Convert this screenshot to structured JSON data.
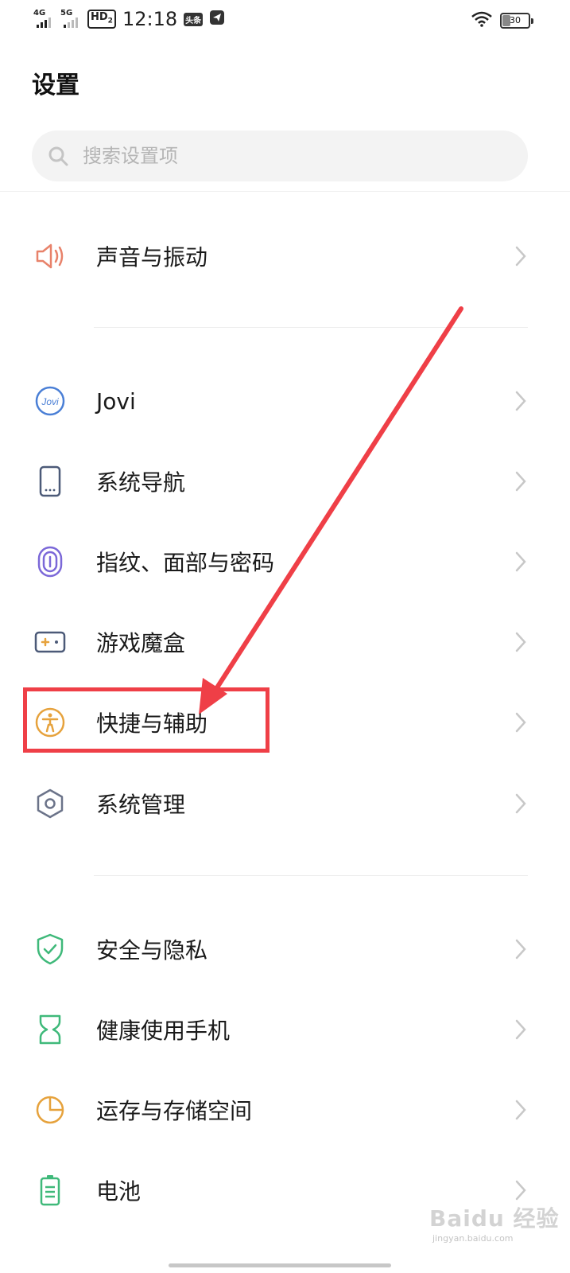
{
  "status_bar": {
    "signal1_label": "4G",
    "signal2_label": "5G",
    "hd_label": "HD",
    "hd_sub": "2",
    "time": "12:18",
    "app_badge": "头条",
    "battery_level": "30"
  },
  "header": {
    "title": "设置"
  },
  "search": {
    "placeholder": "搜索设置项"
  },
  "settings_items": [
    {
      "label": "声音与振动",
      "icon": "speaker-icon",
      "color": "#e8826a"
    },
    {
      "label": "Jovi",
      "icon": "jovi-icon",
      "color": "#4a7fd6"
    },
    {
      "label": "系统导航",
      "icon": "phone-icon",
      "color": "#4c5a78"
    },
    {
      "label": "指纹、面部与密码",
      "icon": "fingerprint-icon",
      "color": "#7b68d8"
    },
    {
      "label": "游戏魔盒",
      "icon": "gamepad-icon",
      "color": "#4c5a78"
    },
    {
      "label": "快捷与辅助",
      "icon": "accessibility-icon",
      "color": "#e6a23c"
    },
    {
      "label": "系统管理",
      "icon": "hexagon-gear-icon",
      "color": "#6b7389"
    },
    {
      "label": "安全与隐私",
      "icon": "shield-check-icon",
      "color": "#3fb97a"
    },
    {
      "label": "健康使用手机",
      "icon": "hourglass-icon",
      "color": "#3fb97a"
    },
    {
      "label": "运存与存储空间",
      "icon": "pie-chart-icon",
      "color": "#e6a23c"
    },
    {
      "label": "电池",
      "icon": "battery-icon",
      "color": "#3fb97a"
    }
  ],
  "annotation": {
    "highlight_color": "#ef3f47"
  },
  "watermark": {
    "main": "Baidu 经验",
    "sub": "jingyan.baidu.com"
  }
}
